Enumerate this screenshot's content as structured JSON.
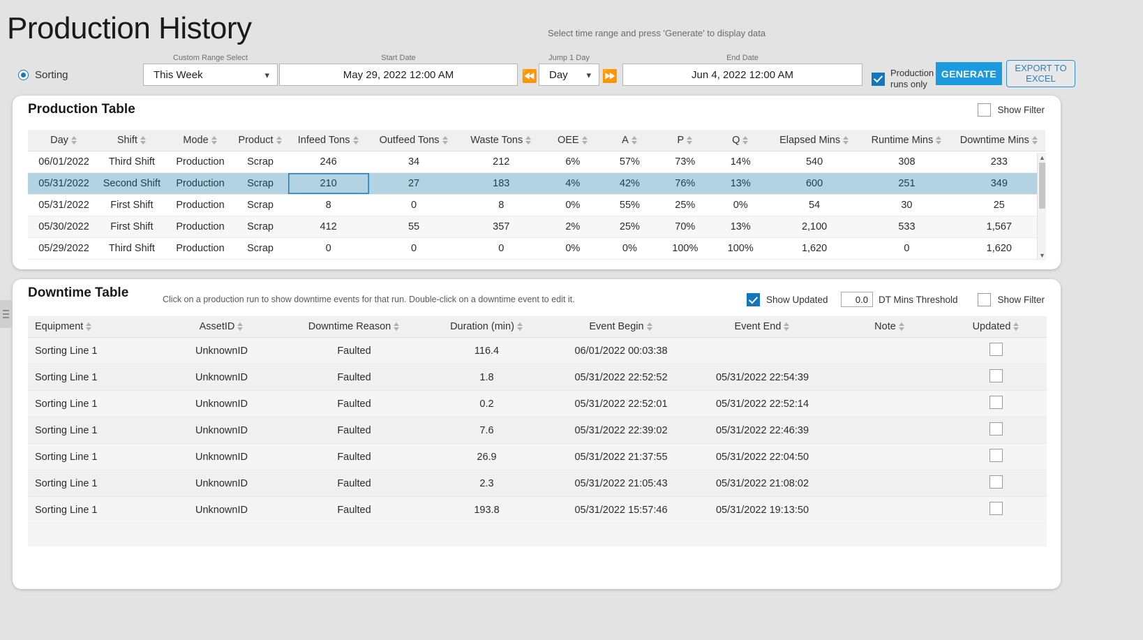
{
  "header": {
    "title": "Production History",
    "hint": "Select time range and press 'Generate' to display data"
  },
  "toolbar": {
    "radio_label": "Sorting",
    "custom_range_caption": "Custom Range Select",
    "custom_range_value": "This Week",
    "start_date_caption": "Start Date",
    "start_date_value": "May 29, 2022 12:00 AM",
    "jump_caption": "Jump 1 Day",
    "jump_value": "Day",
    "end_date_caption": "End Date",
    "end_date_value": "Jun 4, 2022 12:00 AM",
    "prev_icon": "skip-back-icon",
    "next_icon": "skip-forward-icon",
    "production_runs_only_line1": "Production",
    "production_runs_only_line2": "runs only",
    "generate_label": "GENERATE",
    "export_line1": "EXPORT TO",
    "export_line2": "EXCEL"
  },
  "production_table": {
    "title": "Production Table",
    "show_filter_label": "Show Filter",
    "columns": [
      "Day",
      "Shift",
      "Mode",
      "Product",
      "Infeed Tons",
      "Outfeed Tons",
      "Waste Tons",
      "OEE",
      "A",
      "P",
      "Q",
      "Elapsed Mins",
      "Runtime Mins",
      "Downtime Mins"
    ],
    "rows": [
      {
        "day": "06/01/2022",
        "shift": "Third Shift",
        "mode": "Production",
        "product": "Scrap",
        "infeed": "246",
        "outfeed": "34",
        "waste": "212",
        "oee": "6%",
        "a": "57%",
        "p": "73%",
        "q": "14%",
        "elapsed": "540",
        "runtime": "308",
        "downtime": "233",
        "selected": false
      },
      {
        "day": "05/31/2022",
        "shift": "Second Shift",
        "mode": "Production",
        "product": "Scrap",
        "infeed": "210",
        "outfeed": "27",
        "waste": "183",
        "oee": "4%",
        "a": "42%",
        "p": "76%",
        "q": "13%",
        "elapsed": "600",
        "runtime": "251",
        "downtime": "349",
        "selected": true
      },
      {
        "day": "05/31/2022",
        "shift": "First Shift",
        "mode": "Production",
        "product": "Scrap",
        "infeed": "8",
        "outfeed": "0",
        "waste": "8",
        "oee": "0%",
        "a": "55%",
        "p": "25%",
        "q": "0%",
        "elapsed": "54",
        "runtime": "30",
        "downtime": "25",
        "selected": false
      },
      {
        "day": "05/30/2022",
        "shift": "First Shift",
        "mode": "Production",
        "product": "Scrap",
        "infeed": "412",
        "outfeed": "55",
        "waste": "357",
        "oee": "2%",
        "a": "25%",
        "p": "70%",
        "q": "13%",
        "elapsed": "2,100",
        "runtime": "533",
        "downtime": "1,567",
        "selected": false
      },
      {
        "day": "05/29/2022",
        "shift": "Third Shift",
        "mode": "Production",
        "product": "Scrap",
        "infeed": "0",
        "outfeed": "0",
        "waste": "0",
        "oee": "0%",
        "a": "0%",
        "p": "100%",
        "q": "100%",
        "elapsed": "1,620",
        "runtime": "0",
        "downtime": "1,620",
        "selected": false
      }
    ]
  },
  "downtime_table": {
    "title": "Downtime Table",
    "subtitle": "Click on a production run to show downtime events for that run. Double-click on a downtime event to edit it.",
    "show_updated_label": "Show Updated",
    "dt_threshold_value": "0.0",
    "dt_threshold_label": "DT Mins Threshold",
    "show_filter_label": "Show Filter",
    "columns": [
      "Equipment",
      "AssetID",
      "Downtime Reason",
      "Duration (min)",
      "Event Begin",
      "Event End",
      "Note",
      "Updated"
    ],
    "rows": [
      {
        "equipment": "Sorting Line 1",
        "asset": "UnknownID",
        "reason": "Faulted",
        "duration": "116.4",
        "begin": "06/01/2022 00:03:38",
        "end": "",
        "note": "",
        "updated": false
      },
      {
        "equipment": "Sorting Line 1",
        "asset": "UnknownID",
        "reason": "Faulted",
        "duration": "1.8",
        "begin": "05/31/2022 22:52:52",
        "end": "05/31/2022 22:54:39",
        "note": "",
        "updated": false
      },
      {
        "equipment": "Sorting Line 1",
        "asset": "UnknownID",
        "reason": "Faulted",
        "duration": "0.2",
        "begin": "05/31/2022 22:52:01",
        "end": "05/31/2022 22:52:14",
        "note": "",
        "updated": false
      },
      {
        "equipment": "Sorting Line 1",
        "asset": "UnknownID",
        "reason": "Faulted",
        "duration": "7.6",
        "begin": "05/31/2022 22:39:02",
        "end": "05/31/2022 22:46:39",
        "note": "",
        "updated": false
      },
      {
        "equipment": "Sorting Line 1",
        "asset": "UnknownID",
        "reason": "Faulted",
        "duration": "26.9",
        "begin": "05/31/2022 21:37:55",
        "end": "05/31/2022 22:04:50",
        "note": "",
        "updated": false
      },
      {
        "equipment": "Sorting Line 1",
        "asset": "UnknownID",
        "reason": "Faulted",
        "duration": "2.3",
        "begin": "05/31/2022 21:05:43",
        "end": "05/31/2022 21:08:02",
        "note": "",
        "updated": false
      },
      {
        "equipment": "Sorting Line 1",
        "asset": "UnknownID",
        "reason": "Faulted",
        "duration": "193.8",
        "begin": "05/31/2022 15:57:46",
        "end": "05/31/2022 19:13:50",
        "note": "",
        "updated": false
      }
    ]
  },
  "colors": {
    "accent": "#1b9ae0",
    "accent_dark": "#1277bc",
    "selection": "#b3d3e3",
    "page_bg": "#e3e3e3"
  }
}
